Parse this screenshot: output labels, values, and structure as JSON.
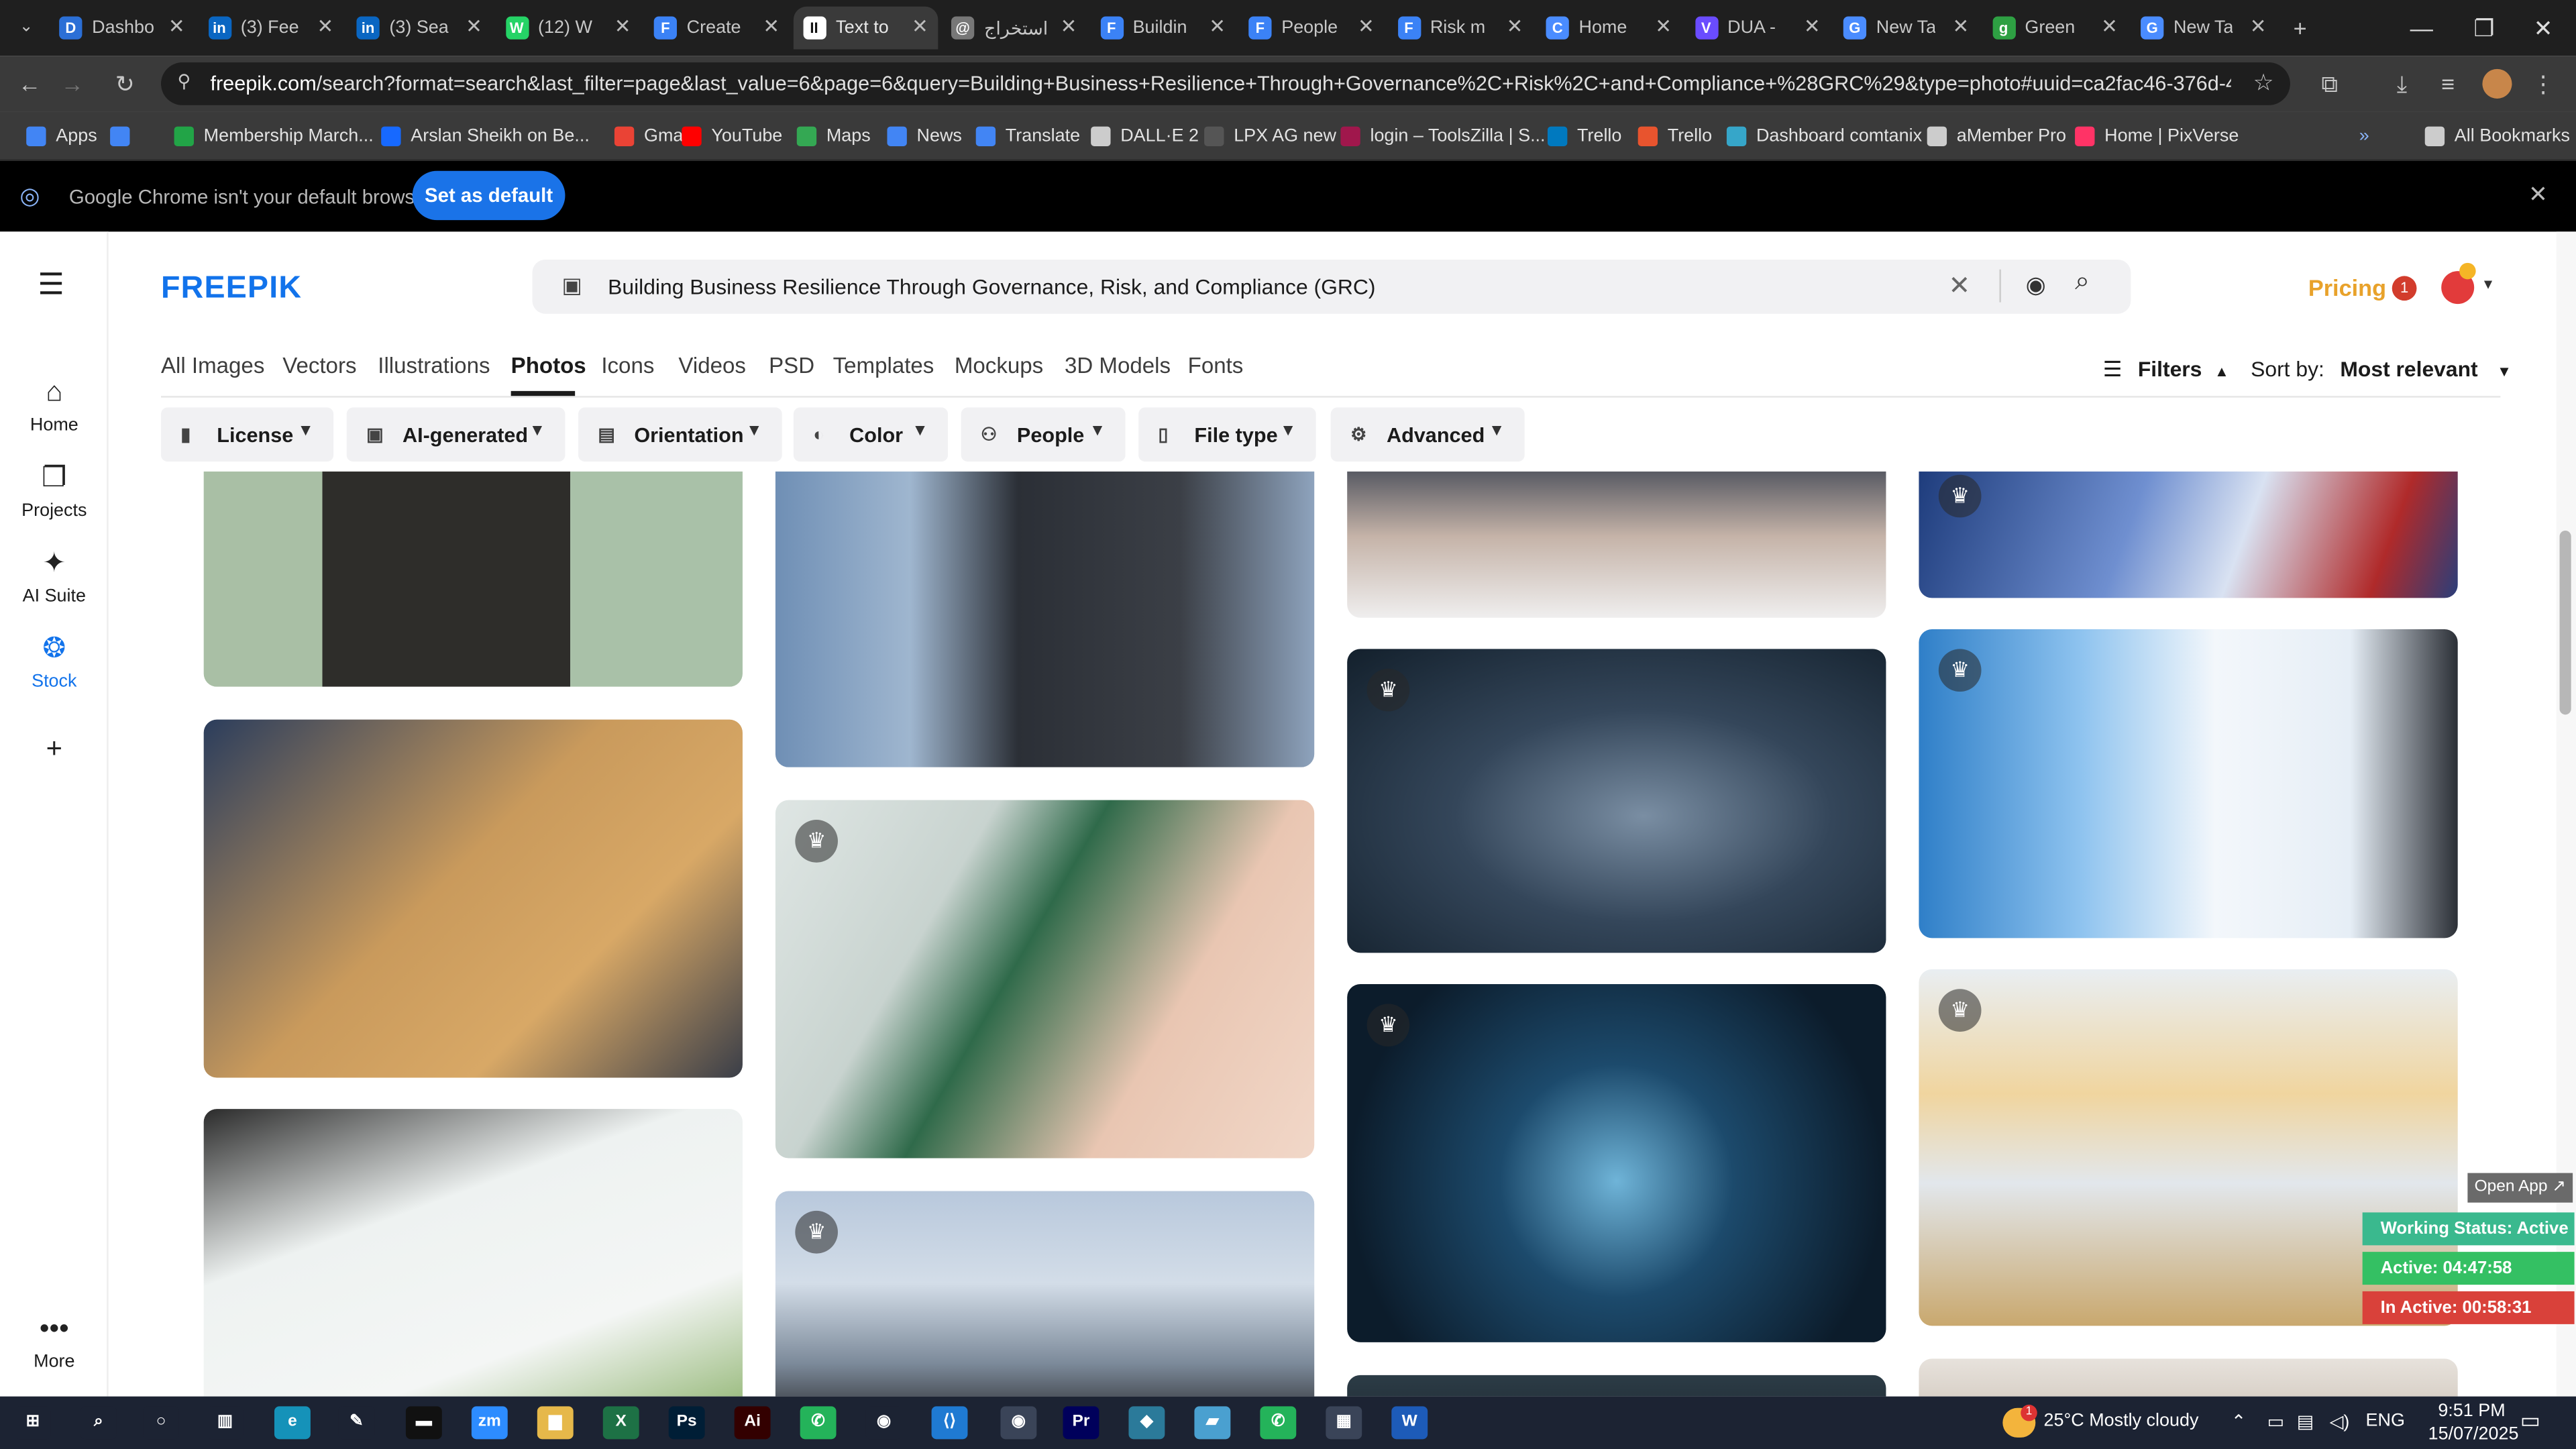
{
  "tabs": [
    {
      "label": "Dashbo",
      "color": "#2b6fd6",
      "glyph": "D"
    },
    {
      "label": "(3) Fee",
      "color": "#0a66c2",
      "glyph": "in"
    },
    {
      "label": "(3) Sea",
      "color": "#0a66c2",
      "glyph": "in"
    },
    {
      "label": "(12) W",
      "color": "#25d366",
      "glyph": "W"
    },
    {
      "label": "Create",
      "color": "#3b82f6",
      "glyph": "F"
    },
    {
      "label": "Text to",
      "color": "#ffffff",
      "glyph": "II"
    },
    {
      "label": "استخراج",
      "color": "#777777",
      "glyph": "@"
    },
    {
      "label": "Buildin",
      "color": "#3b82f6",
      "glyph": "F"
    },
    {
      "label": "People",
      "color": "#3b82f6",
      "glyph": "F"
    },
    {
      "label": "Risk m",
      "color": "#3b82f6",
      "glyph": "F"
    },
    {
      "label": "Home",
      "color": "#4a8cff",
      "glyph": "C"
    },
    {
      "label": "DUA -",
      "color": "#6a4cff",
      "glyph": "V"
    },
    {
      "label": "New Ta",
      "color": "#4a8cff",
      "glyph": "G"
    },
    {
      "label": "Green",
      "color": "#2ea043",
      "glyph": "g"
    },
    {
      "label": "New Ta",
      "color": "#4a8cff",
      "glyph": "G"
    }
  ],
  "address": {
    "domain": "freepik.com",
    "path": "/search?format=search&last_filter=page&last_value=6&page=6&query=Building+Business+Resilience+Through+Governance%2C+Risk%2C+and+Compliance+%28GRC%29&type=photo#uuid=ca2fac46-376d-4ca8-8abf-f91f3712..."
  },
  "bookmarks": [
    {
      "label": "Apps",
      "color": "#4285f4"
    },
    {
      "label": "",
      "color": "#4285f4"
    },
    {
      "label": "Membership March...",
      "color": "#22a447"
    },
    {
      "label": "Arslan Sheikh on Be...",
      "color": "#1769ff"
    },
    {
      "label": "Gmail",
      "color": "#ea4335"
    },
    {
      "label": "YouTube",
      "color": "#ff0000"
    },
    {
      "label": "Maps",
      "color": "#34a853"
    },
    {
      "label": "News",
      "color": "#4285f4"
    },
    {
      "label": "Translate",
      "color": "#4285f4"
    },
    {
      "label": "DALL·E 2",
      "color": "#cccccc"
    },
    {
      "label": "LPX AG new",
      "color": "#555555"
    },
    {
      "label": "login – ToolsZilla | S...",
      "color": "#a0174c"
    },
    {
      "label": "Trello",
      "color": "#0079bf"
    },
    {
      "label": "Trello",
      "color": "#e8542e"
    },
    {
      "label": "Dashboard comtanix",
      "color": "#36a6c9"
    },
    {
      "label": "aMember Pro",
      "color": "#cccccc"
    },
    {
      "label": "Home | PixVerse",
      "color": "#ff3366"
    },
    {
      "label": "All Bookmarks",
      "color": "#cccccc"
    }
  ],
  "default_bar": {
    "message": "Google Chrome isn't your default browser",
    "button": "Set as default"
  },
  "rail": [
    {
      "label": "Home",
      "icon": "home-icon",
      "glyph": "⌂"
    },
    {
      "label": "Projects",
      "icon": "folder-icon",
      "glyph": "❐"
    },
    {
      "label": "AI Suite",
      "icon": "sparkle-icon",
      "glyph": "✦"
    },
    {
      "label": "Stock",
      "icon": "stock-icon",
      "glyph": "❂"
    },
    {
      "label": "",
      "icon": "plus-icon",
      "glyph": "+"
    },
    {
      "label": "More",
      "icon": "more-icon",
      "glyph": "•••"
    }
  ],
  "header": {
    "logo": "FREEPIK",
    "query": "Building Business Resilience Through Governance, Risk, and Compliance (GRC)",
    "pricing": "Pricing",
    "notif_count": "1"
  },
  "categories": [
    "All Images",
    "Vectors",
    "Illustrations",
    "Photos",
    "Icons",
    "Videos",
    "PSD",
    "Templates",
    "Mockups",
    "3D Models",
    "Fonts"
  ],
  "selected_category": "Photos",
  "filters": [
    {
      "label": "License",
      "icon": "license-icon",
      "glyph": "▮"
    },
    {
      "label": "AI-generated",
      "icon": "ai-icon",
      "glyph": "▣"
    },
    {
      "label": "Orientation",
      "icon": "orientation-icon",
      "glyph": "▤"
    },
    {
      "label": "Color",
      "icon": "palette-icon",
      "glyph": "◐"
    },
    {
      "label": "People",
      "icon": "people-icon",
      "glyph": "⚇"
    },
    {
      "label": "File type",
      "icon": "file-icon",
      "glyph": "▯"
    },
    {
      "label": "Advanced",
      "icon": "settings-icon",
      "glyph": "⚙"
    }
  ],
  "sort": {
    "filters_label": "Filters",
    "sort_label": "Sort by:",
    "sort_value": "Most relevant"
  },
  "photos": [
    {
      "id": "hand-blocks",
      "col": 0,
      "premium": false,
      "bg": "linear-gradient(90deg,#a9bfa5 0%,#a9bfa5 22%,#2e2d2a 22%,#2e2d2a 68%,#a9c1a8 68%)"
    },
    {
      "id": "desk-charts",
      "col": 0,
      "premium": false,
      "bg": "linear-gradient(135deg,#2b3d5c 0%,#c99a5c 45%,#d8a866 70%,#3a3e48 100%)"
    },
    {
      "id": "team-table",
      "col": 0,
      "premium": false,
      "bg": "linear-gradient(160deg,#2b2b2b 0%,#eef2f1 35%,#f4f6f5 70%,#8fb470 100%)"
    },
    {
      "id": "suit-building",
      "col": 1,
      "premium": false,
      "bg": "linear-gradient(90deg,#6f8fb5 0%,#9fb6cf 25%,#2b2f36 45%,#3b3f46 75%,#8ea3bd 100%)"
    },
    {
      "id": "recycle-hands",
      "col": 1,
      "premium": true,
      "bg": "linear-gradient(120deg,#dfe6e4 0%,#c8d3cf 30%,#2f6a4a 45%,#e9c6b2 70%,#f1d7c8 100%)"
    },
    {
      "id": "man-tablet-city",
      "col": 1,
      "premium": true,
      "bg": "linear-gradient(180deg,#b8c8dc 0%,#d3dde8 40%,#7c8a9a 75%,#2e2f33 100%)"
    },
    {
      "id": "meeting-table",
      "col": 2,
      "premium": false,
      "bg": "linear-gradient(180deg,#3d4452 0%,#c5b3a8 50%,#efeeee 100%)"
    },
    {
      "id": "warehouse-team",
      "col": 2,
      "premium": true,
      "bg": "radial-gradient(ellipse at 55% 55%,#7a8ea3 0%,#34465a 45%,#13202c 100%)"
    },
    {
      "id": "network-shield",
      "col": 2,
      "premium": true,
      "bg": "radial-gradient(circle at 50% 55%,#6fb4d8 0%,#1c4a6c 35%,#0c1c2b 80%)"
    },
    {
      "id": "dark-bottom",
      "col": 2,
      "premium": false,
      "bg": "linear-gradient(180deg,#2c3c46 0%,#1c2730 100%)"
    },
    {
      "id": "flag-lock",
      "col": 3,
      "premium": true,
      "bg": "linear-gradient(110deg,#1c3a7a 0%,#6f8fd0 40%,#d9e2f2 60%,#b02a2a 85%,#2a3e7a 100%)"
    },
    {
      "id": "shield-knights",
      "col": 3,
      "premium": true,
      "bg": "linear-gradient(90deg,#2f7fc8 0%,#8ec3ef 30%,#f3f7fb 55%,#e6eef6 80%,#2b2f36 100%)"
    },
    {
      "id": "figures-chart",
      "col": 3,
      "premium": true,
      "bg": "linear-gradient(180deg,#e9eef2 0%,#f0d59f 35%,#e2e7ec 60%,#c9a86e 100%)"
    },
    {
      "id": "bottom-right",
      "col": 3,
      "premium": false,
      "bg": "linear-gradient(180deg,#e7e2dc 0%,#cfc5ba 100%)"
    }
  ],
  "time_widget": {
    "open_app": "Open App ↗",
    "working": "Working Status: Active",
    "active": "Active: 04:47:58",
    "inactive": "In Active: 00:58:31",
    "colors": {
      "working": "#3ab98e",
      "active": "#34c063",
      "inactive": "#d9413a"
    }
  },
  "taskbar": {
    "apps": [
      {
        "name": "windows-start-icon",
        "glyph": "⊞",
        "color": "#1c2333"
      },
      {
        "name": "search-icon",
        "glyph": "⌕",
        "color": "#1c2333"
      },
      {
        "name": "cortana-icon",
        "glyph": "○",
        "color": "#1c2333"
      },
      {
        "name": "task-view-icon",
        "glyph": "▥",
        "color": "#1c2333"
      },
      {
        "name": "edge-icon",
        "glyph": "e",
        "color": "#1592b9"
      },
      {
        "name": "pen-icon",
        "glyph": "✎",
        "color": "#1c2333"
      },
      {
        "name": "terminal-icon",
        "glyph": "▬",
        "color": "#111111"
      },
      {
        "name": "zoom-icon",
        "glyph": "zm",
        "color": "#2d8cff"
      },
      {
        "name": "explorer-icon",
        "glyph": "▆",
        "color": "#e6b84a"
      },
      {
        "name": "excel-icon",
        "glyph": "X",
        "color": "#1d7145"
      },
      {
        "name": "photoshop-icon",
        "glyph": "Ps",
        "color": "#001e36"
      },
      {
        "name": "illustrator-icon",
        "glyph": "Ai",
        "color": "#330000"
      },
      {
        "name": "green-app-icon",
        "glyph": "✆",
        "color": "#24b35a"
      },
      {
        "name": "chrome-icon",
        "glyph": "◉",
        "color": "#1c2333"
      },
      {
        "name": "vscode-icon",
        "glyph": "⟨⟩",
        "color": "#1f7ad2"
      },
      {
        "name": "chrome-active-icon",
        "glyph": "◉",
        "color": "#3a4458"
      },
      {
        "name": "premiere-icon",
        "glyph": "Pr",
        "color": "#00005b"
      },
      {
        "name": "app-diamond-icon",
        "glyph": "◆",
        "color": "#2b7a9a"
      },
      {
        "name": "app-note-icon",
        "glyph": "▰",
        "color": "#4aa0d0"
      },
      {
        "name": "green-app2-icon",
        "glyph": "✆",
        "color": "#24b35a"
      },
      {
        "name": "calculator-icon",
        "glyph": "▦",
        "color": "#3a4458"
      },
      {
        "name": "word-icon",
        "glyph": "W",
        "color": "#1d5bb8"
      }
    ],
    "weather": "25°C  Mostly cloudy",
    "lang": "ENG",
    "time": "9:51 PM",
    "date": "15/07/2025",
    "weather_badge": "1"
  }
}
